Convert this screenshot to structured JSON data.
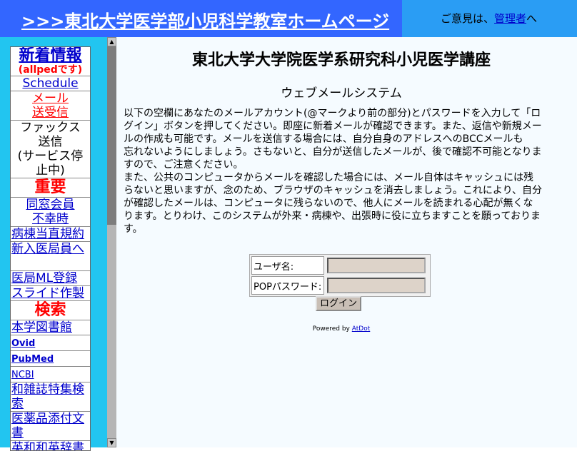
{
  "header": {
    "title": ">>>東北大学医学部小児科学教室ホームページ",
    "feedback_prefix": "ご意見は、",
    "admin_link": "管理者",
    "feedback_suffix": "へ"
  },
  "sidebar": {
    "items": [
      {
        "label": "新着情報"
      },
      {
        "label": "(allpedです)"
      },
      {
        "label": "Schedule"
      },
      {
        "label": "メール"
      },
      {
        "label": "送受信"
      },
      {
        "label": "ファックス"
      },
      {
        "label": "送信"
      },
      {
        "label": "(サービス停"
      },
      {
        "label": "止中)"
      },
      {
        "label": "重要"
      },
      {
        "label": "同窓会員"
      },
      {
        "label": "不幸時"
      },
      {
        "label": "病棟当直規約"
      },
      {
        "label": "新入医局員へ"
      },
      {
        "label": "医局ML登録"
      },
      {
        "label": "スライド作製"
      },
      {
        "label": "検索"
      },
      {
        "label": "本学図書館"
      },
      {
        "label": "Ovid"
      },
      {
        "label": "PubMed"
      },
      {
        "label": "NCBI"
      },
      {
        "label": "和雑誌特集検"
      },
      {
        "label": "索"
      },
      {
        "label": "医薬品添付文"
      },
      {
        "label": "書"
      },
      {
        "label": "英和和英辞書"
      }
    ]
  },
  "main": {
    "title": "東北大学大学院医学系研究科小児医学講座",
    "subtitle": "ウェブメールシステム",
    "para": [
      "以下の空欄にあなたのメールアカウント(@マークより前の部分)とパスワードを入力して「ロ",
      "グイン」ボタンを押してください。即座に新着メールが確認できます。また、返信や新規メー",
      "ルの作成も可能です。メールを送信する場合には、自分自身のアドレスへのBCCメールも",
      "忘れないようにしましょう。さもないと、自分が送信したメールが、後で確認不可能となりま",
      "すので、ご注意ください。",
      "また、公共のコンピュータからメールを確認した場合には、メール自体はキャッシュには残",
      "らないと思いますが、念のため、ブラウザのキャッシュを消去しましょう。これにより、自分",
      "が確認したメールは、コンピュータに残らないので、他人にメールを読まれる心配が無くな",
      "ります。とりわけ、このシステムが外来・病棟や、出張時に役に立ちますことを願っておりま",
      "す。"
    ],
    "username_label": "ユーザ名:",
    "password_label": "POPパスワード:",
    "login_button": "ログイン",
    "powered_by": "Powered by",
    "powered_link": "AtDot"
  }
}
